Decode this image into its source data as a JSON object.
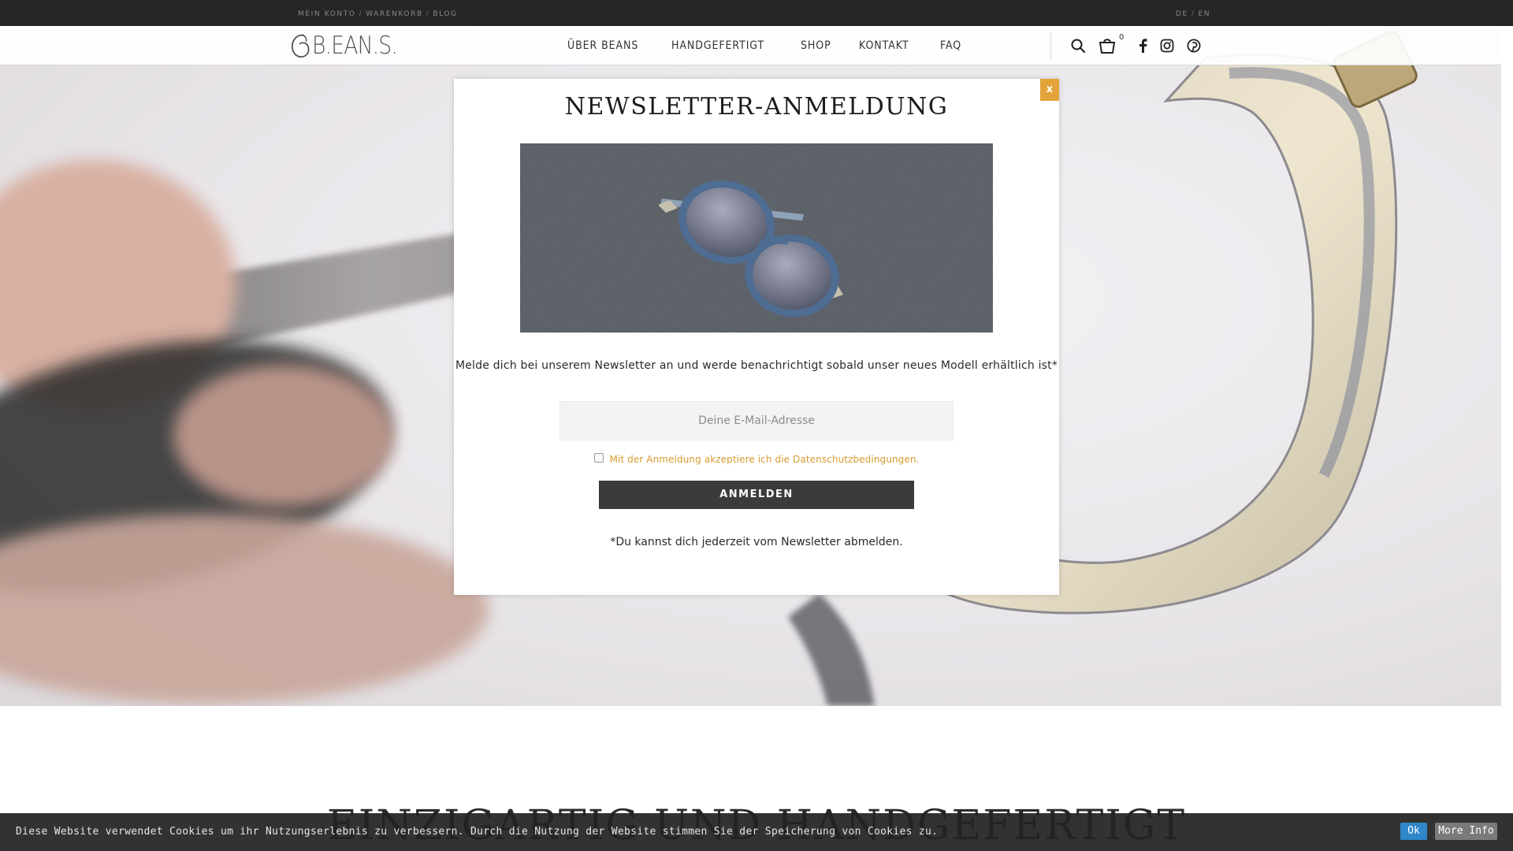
{
  "topbar": {
    "links": [
      "MEIN KONTO",
      "WARENKORB",
      "BLOG"
    ],
    "separator": "/",
    "languages": [
      "DE",
      "EN"
    ]
  },
  "header": {
    "logo_text": "B.EAN.S.",
    "nav": [
      "ÜBER BEANS",
      "HANDGEFERTIGT",
      "SHOP",
      "KONTAKT",
      "FAQ"
    ],
    "cart_count": "0",
    "icons": [
      "search-icon",
      "cart-icon",
      "facebook-icon",
      "instagram-icon",
      "pinterest-icon"
    ]
  },
  "modal": {
    "close_label": "x",
    "title": "NEWSLETTER-ANMELDUNG",
    "description": "Melde dich bei unserem Newsletter an und werde benachrichtigt sobald unser neues Modell erhältlich ist*",
    "email_placeholder": "Deine E-Mail-Adresse",
    "email_value": "",
    "consent_text": "Mit der Anmeldung akzeptiere ich die Datenschutzbedingungen.",
    "consent_checked": false,
    "submit_label": "ANMELDEN",
    "note": "*Du kannst dich jederzeit vom Newsletter abmelden."
  },
  "section_heading": "EINZIGARTIG UND HANDGEFERTIGT",
  "cookie": {
    "text": "Diese Website verwendet Cookies um ihr Nutzungserlebnis zu verbessern. Durch die Nutzung der Website stimmen Sie der Speicherung von Cookies zu.",
    "ok_label": "Ok",
    "more_label": "More Info"
  },
  "colors": {
    "accent": "#e2a43a",
    "consent_text": "#d89a2e",
    "topbar_bg": "#262626",
    "button_bg": "#3b3b3b",
    "cookie_ok": "#2f86c9"
  }
}
